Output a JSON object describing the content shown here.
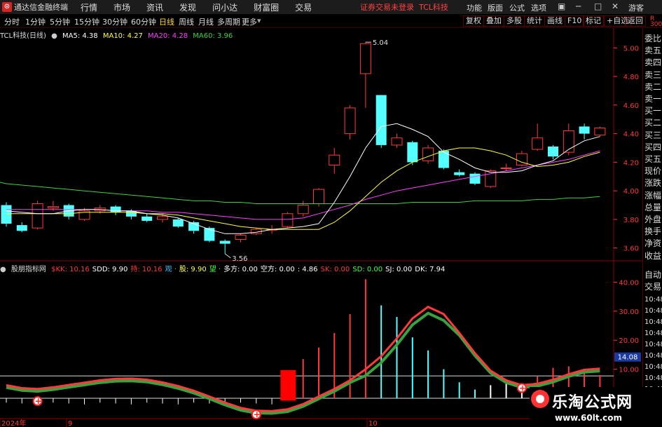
{
  "menubar": {
    "app_title": "通达信金融终端",
    "menus": [
      "行情",
      "市场",
      "资讯",
      "发现",
      "问小达",
      "财富圈",
      "交易"
    ],
    "notice": "证券交易未登录",
    "stock_name": "TCL科技",
    "right_menus": [
      "功能",
      "版面",
      "公式",
      "选项"
    ],
    "guest": "游客"
  },
  "periods": {
    "items": [
      "分时",
      "1分钟",
      "5分钟",
      "15分钟",
      "30分钟",
      "60分钟",
      "日线",
      "周线",
      "月线",
      "多周期",
      "更多"
    ],
    "active": "日线"
  },
  "toolbar": [
    "复权",
    "叠加",
    "多股",
    "统计",
    "画线",
    "F10",
    "标记",
    "+自选",
    "返回"
  ],
  "main_legend": {
    "title": "TCL科技(日线)",
    "ma5": "MA5: 4.38",
    "ma10": "MA10: 4.27",
    "ma20": "MA20: 4.28",
    "ma60": "MA60: 3.96"
  },
  "indicator_legend": {
    "name": "股朋指标网",
    "items": [
      {
        "text": "$KK: 10.16",
        "color": "#ff3a3a"
      },
      {
        "text": "SDD: 9.90",
        "color": "#ffffff"
      },
      {
        "text": "持: 10.16",
        "color": "#ff3a3a"
      },
      {
        "text": "观 ·",
        "color": "#40c0ff"
      },
      {
        "text": "股: 9.90",
        "color": "#ffff40"
      },
      {
        "text": "望 ·",
        "color": "#40ff40"
      },
      {
        "text": "多方: 0.00",
        "color": "#ffffff"
      },
      {
        "text": "空方: 0.00",
        "color": "#ffffff"
      },
      {
        "text": ": 4.86",
        "color": "#ffffff"
      },
      {
        "text": "SK: 0.00",
        "color": "#ff3a3a"
      },
      {
        "text": "SD: 0.00",
        "color": "#40ff40"
      },
      {
        "text": "SJ: 0.00",
        "color": "#ffffff"
      },
      {
        "text": "DK: 7.94",
        "color": "#ffffff"
      }
    ]
  },
  "price_axis": [
    "5.00",
    "4.80",
    "4.60",
    "4.40",
    "4.20",
    "4.00",
    "3.80",
    "3.60"
  ],
  "indicator_axis": [
    "40.00",
    "30.00",
    "20.00",
    "10.00"
  ],
  "indicator_current": "14.08",
  "high_marker": "5.04",
  "low_marker": "3.56",
  "date_labels": [
    "2024年",
    "9",
    "10"
  ],
  "right_panel": {
    "top_char": "R",
    "top_num": "300",
    "items": [
      "委比",
      "卖五",
      "卖四",
      "卖三",
      "卖二",
      "卖一",
      "买一",
      "买二",
      "买三",
      "买四",
      "买五",
      "现价",
      "涨跌",
      "涨幅",
      "总量",
      "外盘",
      "换手",
      "净资",
      "收益",
      "自动",
      "交易"
    ],
    "times": [
      "10:48",
      "10:48",
      "10:48",
      "10:48",
      "10:48",
      "10:48",
      "10:48",
      "10:48",
      "10:48",
      "10:48"
    ]
  },
  "watermark": {
    "title": "乐淘公式网",
    "url": "www.60lt.com"
  },
  "colors": {
    "up": "#ff3a3a",
    "down": "#54ffff",
    "ma5": "#ffffff",
    "ma10": "#ffff40",
    "ma20": "#ff40ff",
    "ma60": "#40d040"
  },
  "chart_data": {
    "type": "candlestick",
    "ylim": [
      3.52,
      5.08
    ],
    "candles": [
      {
        "o": 3.9,
        "c": 3.77,
        "h": 3.92,
        "l": 3.75
      },
      {
        "o": 3.76,
        "c": 3.72,
        "h": 3.78,
        "l": 3.71
      },
      {
        "o": 3.74,
        "c": 3.91,
        "h": 3.93,
        "l": 3.73
      },
      {
        "o": 3.88,
        "c": 3.89,
        "h": 3.93,
        "l": 3.86
      },
      {
        "o": 3.9,
        "c": 3.82,
        "h": 3.91,
        "l": 3.8
      },
      {
        "o": 3.8,
        "c": 3.86,
        "h": 3.88,
        "l": 3.79
      },
      {
        "o": 3.86,
        "c": 3.88,
        "h": 3.9,
        "l": 3.84
      },
      {
        "o": 3.89,
        "c": 3.85,
        "h": 3.9,
        "l": 3.83
      },
      {
        "o": 3.86,
        "c": 3.82,
        "h": 3.87,
        "l": 3.8
      },
      {
        "o": 3.82,
        "c": 3.79,
        "h": 3.84,
        "l": 3.78
      },
      {
        "o": 3.8,
        "c": 3.82,
        "h": 3.84,
        "l": 3.78
      },
      {
        "o": 3.8,
        "c": 3.75,
        "h": 3.81,
        "l": 3.74
      },
      {
        "o": 3.78,
        "c": 3.72,
        "h": 3.79,
        "l": 3.7
      },
      {
        "o": 3.74,
        "c": 3.65,
        "h": 3.75,
        "l": 3.64
      },
      {
        "o": 3.65,
        "c": 3.63,
        "h": 3.66,
        "l": 3.56
      },
      {
        "o": 3.66,
        "c": 3.69,
        "h": 3.7,
        "l": 3.64
      },
      {
        "o": 3.7,
        "c": 3.73,
        "h": 3.74,
        "l": 3.69
      },
      {
        "o": 3.73,
        "c": 3.73,
        "h": 3.76,
        "l": 3.7
      },
      {
        "o": 3.75,
        "c": 3.84,
        "h": 3.85,
        "l": 3.74
      },
      {
        "o": 3.84,
        "c": 3.9,
        "h": 3.93,
        "l": 3.82
      },
      {
        "o": 3.91,
        "c": 4.01,
        "h": 4.02,
        "l": 3.89
      },
      {
        "o": 4.18,
        "c": 4.25,
        "h": 4.3,
        "l": 4.12
      },
      {
        "o": 4.4,
        "c": 4.58,
        "h": 4.6,
        "l": 4.36
      },
      {
        "o": 4.82,
        "c": 5.03,
        "h": 5.04,
        "l": 4.58
      },
      {
        "o": 4.67,
        "c": 4.32,
        "h": 4.67,
        "l": 4.3
      },
      {
        "o": 4.32,
        "c": 4.37,
        "h": 4.4,
        "l": 4.3
      },
      {
        "o": 4.34,
        "c": 4.2,
        "h": 4.35,
        "l": 4.18
      },
      {
        "o": 4.21,
        "c": 4.3,
        "h": 4.32,
        "l": 4.19
      },
      {
        "o": 4.28,
        "c": 4.16,
        "h": 4.29,
        "l": 4.15
      },
      {
        "o": 4.13,
        "c": 4.11,
        "h": 4.15,
        "l": 4.1
      },
      {
        "o": 4.12,
        "c": 4.05,
        "h": 4.13,
        "l": 4.04
      },
      {
        "o": 4.03,
        "c": 4.14,
        "h": 4.15,
        "l": 4.02
      },
      {
        "o": 4.16,
        "c": 4.16,
        "h": 4.19,
        "l": 4.14
      },
      {
        "o": 4.18,
        "c": 4.26,
        "h": 4.28,
        "l": 4.17
      },
      {
        "o": 4.29,
        "c": 4.37,
        "h": 4.47,
        "l": 4.28
      },
      {
        "o": 4.31,
        "c": 4.24,
        "h": 4.32,
        "l": 4.22
      },
      {
        "o": 4.27,
        "c": 4.42,
        "h": 4.47,
        "l": 4.25
      },
      {
        "o": 4.45,
        "c": 4.4,
        "h": 4.47,
        "l": 4.36
      },
      {
        "o": 4.39,
        "c": 4.44,
        "h": 4.45,
        "l": 4.38
      }
    ],
    "ma5": [
      3.86,
      3.85,
      3.84,
      3.84,
      3.86,
      3.87,
      3.87,
      3.86,
      3.86,
      3.84,
      3.83,
      3.81,
      3.77,
      3.73,
      3.7,
      3.7,
      3.71,
      3.73,
      3.74,
      3.75,
      3.77,
      3.92,
      4.1,
      4.3,
      4.45,
      4.47,
      4.43,
      4.38,
      4.27,
      4.22,
      4.16,
      4.13,
      4.13,
      4.14,
      4.18,
      4.21,
      4.29,
      4.35,
      4.38
    ],
    "ma10": [
      3.84,
      3.84,
      3.84,
      3.84,
      3.84,
      3.85,
      3.85,
      3.85,
      3.85,
      3.84,
      3.84,
      3.83,
      3.81,
      3.79,
      3.77,
      3.75,
      3.74,
      3.73,
      3.73,
      3.73,
      3.73,
      3.78,
      3.86,
      3.96,
      4.06,
      4.14,
      4.2,
      4.24,
      4.28,
      4.3,
      4.3,
      4.28,
      4.25,
      4.2,
      4.17,
      4.18,
      4.2,
      4.24,
      4.27
    ],
    "ma20": [
      3.87,
      3.87,
      3.87,
      3.87,
      3.87,
      3.87,
      3.87,
      3.86,
      3.86,
      3.86,
      3.85,
      3.85,
      3.84,
      3.83,
      3.82,
      3.81,
      3.8,
      3.8,
      3.8,
      3.81,
      3.84,
      3.87,
      3.9,
      3.94,
      3.97,
      4.0,
      4.02,
      4.04,
      4.06,
      4.08,
      4.1,
      4.12,
      4.14,
      4.16,
      4.18,
      4.2,
      4.22,
      4.25,
      4.28
    ],
    "ma60": [
      4.05,
      4.04,
      4.03,
      4.02,
      4.01,
      4.0,
      3.99,
      3.98,
      3.97,
      3.96,
      3.95,
      3.94,
      3.93,
      3.93,
      3.92,
      3.92,
      3.91,
      3.91,
      3.91,
      3.91,
      3.91,
      3.91,
      3.91,
      3.91,
      3.91,
      3.91,
      3.92,
      3.92,
      3.92,
      3.92,
      3.93,
      3.93,
      3.93,
      3.93,
      3.94,
      3.94,
      3.95,
      3.95,
      3.96
    ],
    "indicator": {
      "ylim": [
        -7,
        43
      ],
      "line": [
        4.5,
        3.5,
        3.2,
        3.8,
        4.6,
        5.4,
        6.2,
        6.7,
        6.8,
        6.4,
        5.5,
        4.2,
        2.6,
        0.6,
        -1.5,
        -3.3,
        -4.3,
        -4.4,
        -3.8,
        -2.0,
        0.6,
        3.2,
        6.2,
        10.0,
        14.5,
        20.6,
        27.5,
        31.5,
        29.0,
        22.5,
        15.5,
        9.5,
        6.2,
        4.5,
        5.0,
        6.4,
        8.3,
        9.8,
        10.2
      ],
      "bars": [
        0,
        0,
        0,
        0,
        0,
        0,
        0,
        0,
        0,
        0,
        0,
        0,
        0,
        0,
        0,
        0,
        0,
        0,
        9.5,
        13.5,
        17.5,
        22.5,
        29.0,
        41.0,
        32.0,
        28.0,
        21.0,
        16.5,
        10.0,
        5.5,
        3.0,
        4.5,
        6.0,
        4.5,
        7.5,
        10.5,
        11.0,
        9.5,
        8.0
      ]
    }
  }
}
